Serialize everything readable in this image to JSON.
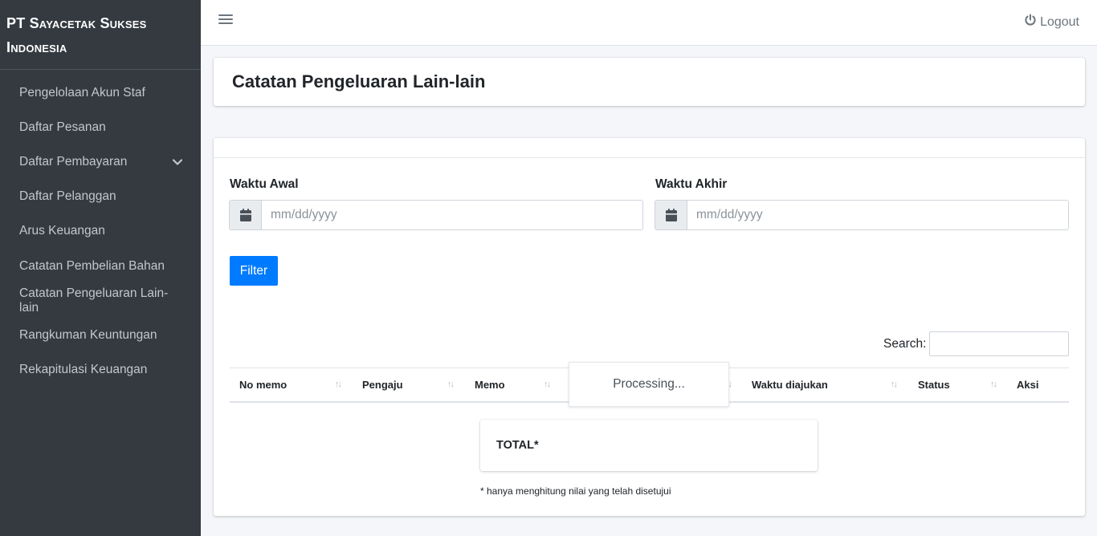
{
  "brand": {
    "line1": "PT Sayacetak Sukses",
    "line2": "Indonesia"
  },
  "sidebar": {
    "items": [
      {
        "label": "Pengelolaan Akun Staf"
      },
      {
        "label": "Daftar Pesanan"
      },
      {
        "label": "Daftar Pembayaran",
        "has_submenu": true
      },
      {
        "label": "Daftar Pelanggan"
      },
      {
        "label": "Arus Keuangan"
      },
      {
        "label": "Catatan Pembelian Bahan"
      },
      {
        "label": "Catatan Pengeluaran Lain-lain"
      },
      {
        "label": "Rangkuman Keuntungan"
      },
      {
        "label": "Rekapitulasi Keuangan"
      }
    ]
  },
  "topbar": {
    "menu_icon": "hamburger-icon",
    "logout_icon": "power-icon",
    "logout_label": "Logout"
  },
  "page": {
    "title": "Catatan Pengeluaran Lain-lain"
  },
  "filters": {
    "start": {
      "label": "Waktu Awal",
      "placeholder": "mm/dd/yyyy",
      "icon": "calendar-icon"
    },
    "end": {
      "label": "Waktu Akhir",
      "placeholder": "mm/dd/yyyy",
      "icon": "calendar-icon"
    },
    "button_label": "Filter"
  },
  "table": {
    "search_label": "Search:",
    "columns": [
      "No memo",
      "Pengaju",
      "Memo",
      "Waktu diajukan",
      "Status",
      "Aksi"
    ],
    "processing_text": "Processing..."
  },
  "summary": {
    "total_label": "TOTAL*",
    "footnote": "* hanya menghitung nilai yang telah disetujui"
  },
  "colors": {
    "sidebar_bg": "#343a40",
    "primary": "#007bff",
    "content_bg": "#f4f6f9"
  }
}
